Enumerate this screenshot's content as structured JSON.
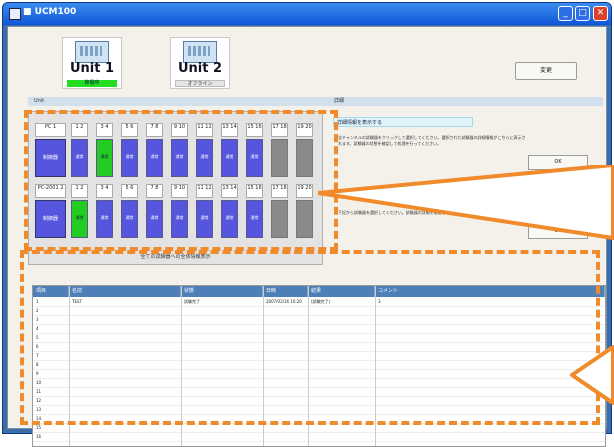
{
  "window": {
    "title": "■ UCM100"
  },
  "titlebar": {
    "min": "_",
    "max": "□",
    "close": "✕"
  },
  "units": [
    {
      "name": "Unit 1",
      "status": "稼働中"
    },
    {
      "name": "Unit 2",
      "status": "オフライン"
    }
  ],
  "toolbar": {
    "change_label": "変更"
  },
  "left_header": "Unit",
  "right_header": "詳細",
  "grid": {
    "row1": {
      "ctrl": {
        "num": "PC\n1",
        "label": "制御器"
      },
      "cells": [
        {
          "num": "1\n2",
          "label": "通常",
          "state": "blue"
        },
        {
          "num": "3\n4",
          "label": "通常",
          "state": "green"
        },
        {
          "num": "5\n6",
          "label": "通常",
          "state": "blue"
        },
        {
          "num": "7\n8",
          "label": "通常",
          "state": "blue"
        },
        {
          "num": "9\n10",
          "label": "通常",
          "state": "blue"
        },
        {
          "num": "11\n12",
          "label": "通常",
          "state": "blue"
        },
        {
          "num": "13\n14",
          "label": "通常",
          "state": "blue"
        },
        {
          "num": "15\n16",
          "label": "通常",
          "state": "blue"
        },
        {
          "num": "17\n18",
          "label": "",
          "state": "gray"
        },
        {
          "num": "19\n20",
          "label": "",
          "state": "gray"
        }
      ]
    },
    "row2": {
      "ctrl": {
        "num": "PC-2001\n2",
        "label": "制御器"
      },
      "cells": [
        {
          "num": "1\n2",
          "label": "通常",
          "state": "green"
        },
        {
          "num": "3\n4",
          "label": "通常",
          "state": "blue"
        },
        {
          "num": "5\n6",
          "label": "通常",
          "state": "blue"
        },
        {
          "num": "7\n8",
          "label": "通常",
          "state": "blue"
        },
        {
          "num": "9\n10",
          "label": "通常",
          "state": "blue"
        },
        {
          "num": "11\n12",
          "label": "通常",
          "state": "blue"
        },
        {
          "num": "13\n14",
          "label": "通常",
          "state": "blue"
        },
        {
          "num": "15\n16",
          "label": "通常",
          "state": "blue"
        },
        {
          "num": "17\n18",
          "label": "",
          "state": "gray"
        },
        {
          "num": "19\n20",
          "label": "",
          "state": "gray"
        }
      ]
    },
    "footer": "全ての試験器への全体情報表示"
  },
  "panels": [
    {
      "title": "詳細情報を表示する",
      "text": "全チャンネルの試験器をクリックして選択してください。選択された試験器の詳細情報がこちらに表示されます。試験器の状態を確認して処理を行ってください。",
      "button": "OK"
    },
    {
      "title": "",
      "text": "下記から試験器を選択してください。試験器の詳細を確認して操作を行ってください。",
      "button": "OK"
    }
  ],
  "table": {
    "columns": [
      "項目",
      "名前",
      "状態",
      "日時",
      "結果",
      "コメント"
    ],
    "rows": [
      [
        "1",
        "TEST",
        "試験完了",
        "2007/02/16 10:20",
        "(試験完了)",
        "3"
      ],
      [
        "2",
        "",
        "",
        "",
        "",
        ""
      ],
      [
        "3",
        "",
        "",
        "",
        "",
        ""
      ],
      [
        "4",
        "",
        "",
        "",
        "",
        ""
      ],
      [
        "5",
        "",
        "",
        "",
        "",
        ""
      ],
      [
        "6",
        "",
        "",
        "",
        "",
        ""
      ],
      [
        "7",
        "",
        "",
        "",
        "",
        ""
      ],
      [
        "8",
        "",
        "",
        "",
        "",
        ""
      ],
      [
        "9",
        "",
        "",
        "",
        "",
        ""
      ],
      [
        "10",
        "",
        "",
        "",
        "",
        ""
      ],
      [
        "11",
        "",
        "",
        "",
        "",
        ""
      ],
      [
        "12",
        "",
        "",
        "",
        "",
        ""
      ],
      [
        "13",
        "",
        "",
        "",
        "",
        ""
      ],
      [
        "14",
        "",
        "",
        "",
        "",
        ""
      ],
      [
        "15",
        "",
        "",
        "",
        "",
        ""
      ],
      [
        "16",
        "",
        "",
        "",
        "",
        ""
      ]
    ]
  },
  "colors": {
    "accent": "#f08a2b",
    "slot_blue": "#5555dd",
    "slot_green": "#22cc22",
    "header_blue": "#4e7fb8"
  }
}
